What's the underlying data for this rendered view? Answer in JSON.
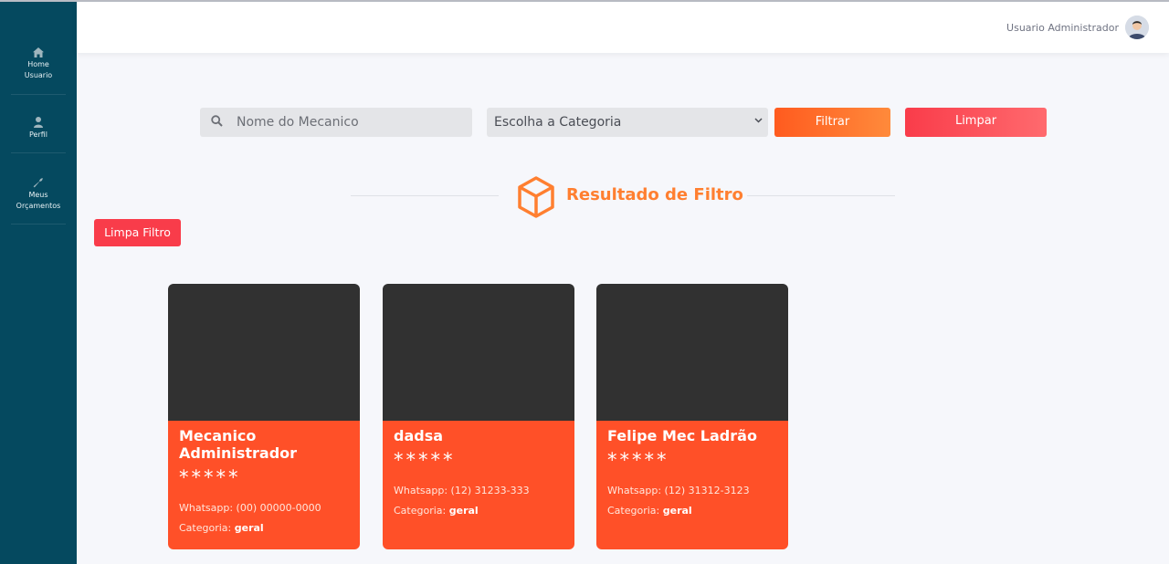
{
  "sidebar": {
    "items": [
      {
        "icon": "home-icon",
        "line1": "Home",
        "line2": "Usuario"
      },
      {
        "icon": "user-icon",
        "line1": "Perfil",
        "line2": ""
      },
      {
        "icon": "wrench-icon",
        "line1": "Meus",
        "line2": "Orçamentos"
      }
    ]
  },
  "header": {
    "user_name": "Usuario Administrador"
  },
  "filters": {
    "search_placeholder": "Nome do Mecanico",
    "category_selected": "Escolha a Categoria",
    "filter_button": "Filtrar",
    "clear_button": "Limpar"
  },
  "results": {
    "title": "Resultado de Filtro",
    "clear_filter_button": "Limpa Filtro"
  },
  "cards": [
    {
      "name": "Mecanico Administrador",
      "stars": "*****",
      "whatsapp_label": "Whatsapp:",
      "whatsapp": "(00) 00000-0000",
      "category_label": "Categoria:",
      "category": "geral"
    },
    {
      "name": "dadsa",
      "stars": "*****",
      "whatsapp_label": "Whatsapp:",
      "whatsapp": "(12) 31233-333",
      "category_label": "Categoria:",
      "category": "geral"
    },
    {
      "name": "Felipe Mec Ladrão",
      "stars": "*****",
      "whatsapp_label": "Whatsapp:",
      "whatsapp": "(12) 31312-3123",
      "category_label": "Categoria:",
      "category": "geral"
    }
  ],
  "colors": {
    "sidebar": "#05495f",
    "accent_orange": "#ff7f30",
    "card_body": "#ff5028",
    "danger": "#f93c4a"
  }
}
